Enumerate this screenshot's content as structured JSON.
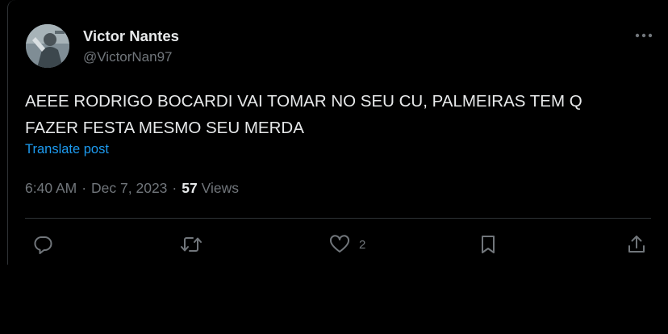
{
  "post": {
    "author": {
      "display_name": "Victor Nantes",
      "handle": "@VictorNan97"
    },
    "text_lines": [
      "AEEE RODRIGO BOCARDI VAI TOMAR NO SEU CU, PALMEIRAS TEM Q",
      "FAZER FESTA MESMO SEU MERDA"
    ],
    "translate_label": "Translate post",
    "time": "6:40 AM",
    "separator": "·",
    "date": "Dec 7, 2023",
    "views_count": "57",
    "views_label": "Views",
    "likes_count": "2"
  },
  "icons": {
    "more": "more-horizontal-icon",
    "reply": "reply-icon",
    "repost": "repost-icon",
    "like": "heart-icon",
    "bookmark": "bookmark-icon",
    "share": "share-icon"
  },
  "colors": {
    "background": "#000000",
    "primary_text": "#e7e9ea",
    "secondary_text": "#71767b",
    "link": "#1d9bf0",
    "divider": "#2f3336"
  }
}
